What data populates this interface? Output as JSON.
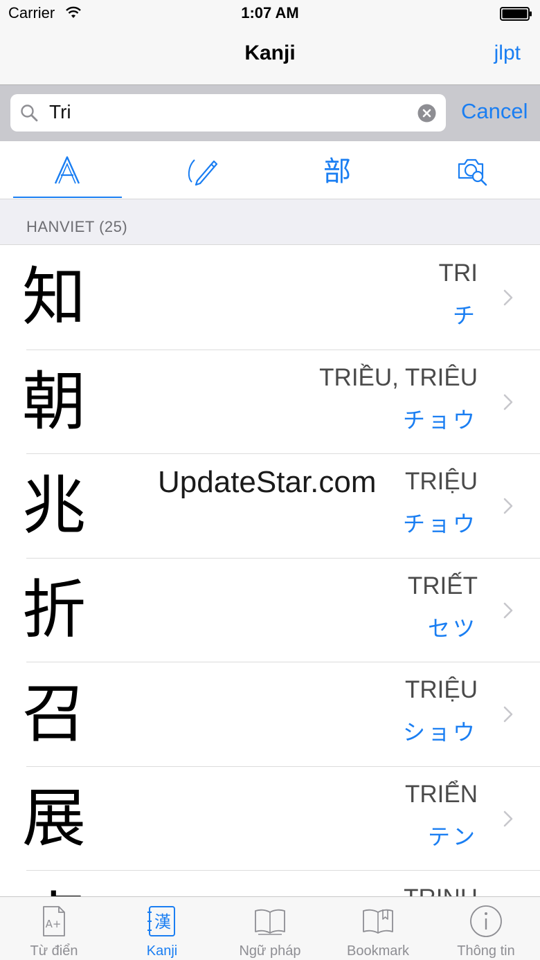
{
  "status_bar": {
    "carrier": "Carrier",
    "time": "1:07 AM"
  },
  "nav": {
    "title": "Kanji",
    "right_button": "jlpt"
  },
  "search": {
    "value": "Tri",
    "cancel_label": "Cancel"
  },
  "mode_tabs": [
    {
      "icon": "letter-a-icon",
      "selected": true
    },
    {
      "icon": "handwriting-pen-icon",
      "selected": false
    },
    {
      "icon": "radical-icon",
      "glyph": "部",
      "selected": false
    },
    {
      "icon": "camera-search-icon",
      "selected": false
    }
  ],
  "section": {
    "label": "HANVIET (25)"
  },
  "rows": [
    {
      "kanji": "知",
      "reading": "TRI",
      "kana": "チ"
    },
    {
      "kanji": "朝",
      "reading": "TRIỀU, TRIÊU",
      "kana": "チョウ"
    },
    {
      "kanji": "兆",
      "reading": "TRIỆU",
      "kana": "チョウ"
    },
    {
      "kanji": "折",
      "reading": "TRIẾT",
      "kana": "セツ"
    },
    {
      "kanji": "召",
      "reading": "TRIỆU",
      "kana": "ショウ"
    },
    {
      "kanji": "展",
      "reading": "TRIỂN",
      "kana": "テン"
    },
    {
      "kanji": "貞",
      "reading": "TRINH",
      "kana": ""
    }
  ],
  "watermark": "UpdateStar.com",
  "tab_bar": [
    {
      "label": "Từ điển",
      "icon": "dictionary-icon",
      "active": false
    },
    {
      "label": "Kanji",
      "icon": "kanji-icon",
      "glyph": "漢",
      "active": true
    },
    {
      "label": "Ngữ pháp",
      "icon": "book-icon",
      "active": false
    },
    {
      "label": "Bookmark",
      "icon": "bookmark-book-icon",
      "active": false
    },
    {
      "label": "Thông tin",
      "icon": "info-icon",
      "active": false
    }
  ],
  "colors": {
    "accent": "#1a7ef2",
    "reading_text": "#4a4a4a",
    "section_bg": "#efeff4",
    "search_bg": "#c9c9ce"
  }
}
